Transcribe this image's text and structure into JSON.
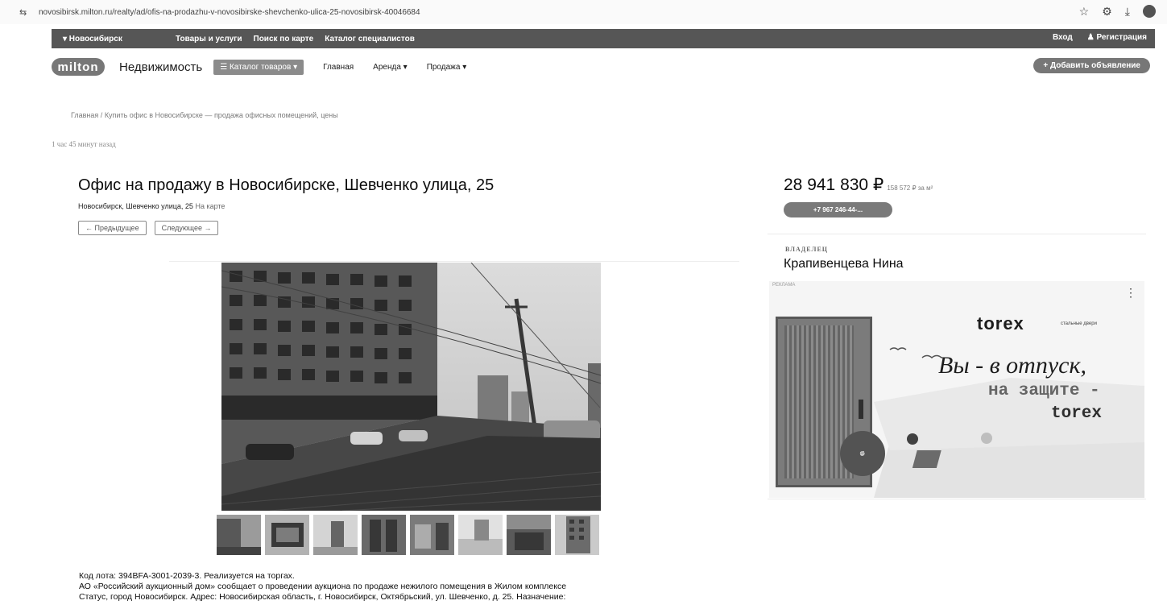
{
  "browser": {
    "url": "novosibirsk.milton.ru/realty/ad/ofis-na-prodazhu-v-novosibirske-shevchenko-ulica-25-novosibirsk-40046684",
    "icons": [
      "site-info-icon",
      "star-icon",
      "extensions-icon",
      "download-icon",
      "profile-icon"
    ]
  },
  "topnav": {
    "city": "▾ Новосибирск",
    "links": [
      "Товары и услуги",
      "Поиск по карте",
      "Каталог специалистов"
    ],
    "login": "Вход",
    "register": "Регистрация"
  },
  "header": {
    "logo_text": "milton",
    "brand": "Недвижимость",
    "catalog_button": "☰ Каталог товаров ▾",
    "nav": [
      "Главная",
      "Аренда ▾",
      "Продажа ▾"
    ],
    "add_button": "+ Добавить объявление"
  },
  "breadcrumb": {
    "home": "Главная",
    "separator": "/",
    "current": "Купить офис в Новосибирске — продажа офисных помещений, цены"
  },
  "listing": {
    "time_ago": "1 час 45 минут назад",
    "title": "Офис на продажу в Новосибирске, Шевченко улица, 25",
    "address": "Новосибирск, Шевченко улица, 25",
    "map_link": "На карте",
    "prev_button": "← Предыдущее",
    "next_button": "Следующее →",
    "thumbnail_count": 8,
    "description_line1": "Код лота: 394BFA-3001-2039-3. Реализуется на торгах.",
    "description_line2": "АО «Российский аукционный дом» сообщает о проведении аукциона по продаже нежилого помещения в Жилом комплексе",
    "description_line3": "Статус, город Новосибирск. Адрес: Новосибирская область, г. Новосибирск, Октябрьский, ул. Шевченко, д. 25. Назначение:"
  },
  "sidebar": {
    "price": "28 941 830 ₽",
    "price_per_m2": "158 572 ₽ за м²",
    "phone_button": "+7 967 246-44-...",
    "owner_label": "ВЛАДЕЛЕЦ",
    "owner_name": "Крапивенцева Нина"
  },
  "ad": {
    "label": "РЕКЛАМА",
    "brand": "torex",
    "brand_sub": "стальные двери",
    "slogan1": "Вы - в отпуск,",
    "slogan2": "на защите -",
    "slogan3": "torex"
  }
}
